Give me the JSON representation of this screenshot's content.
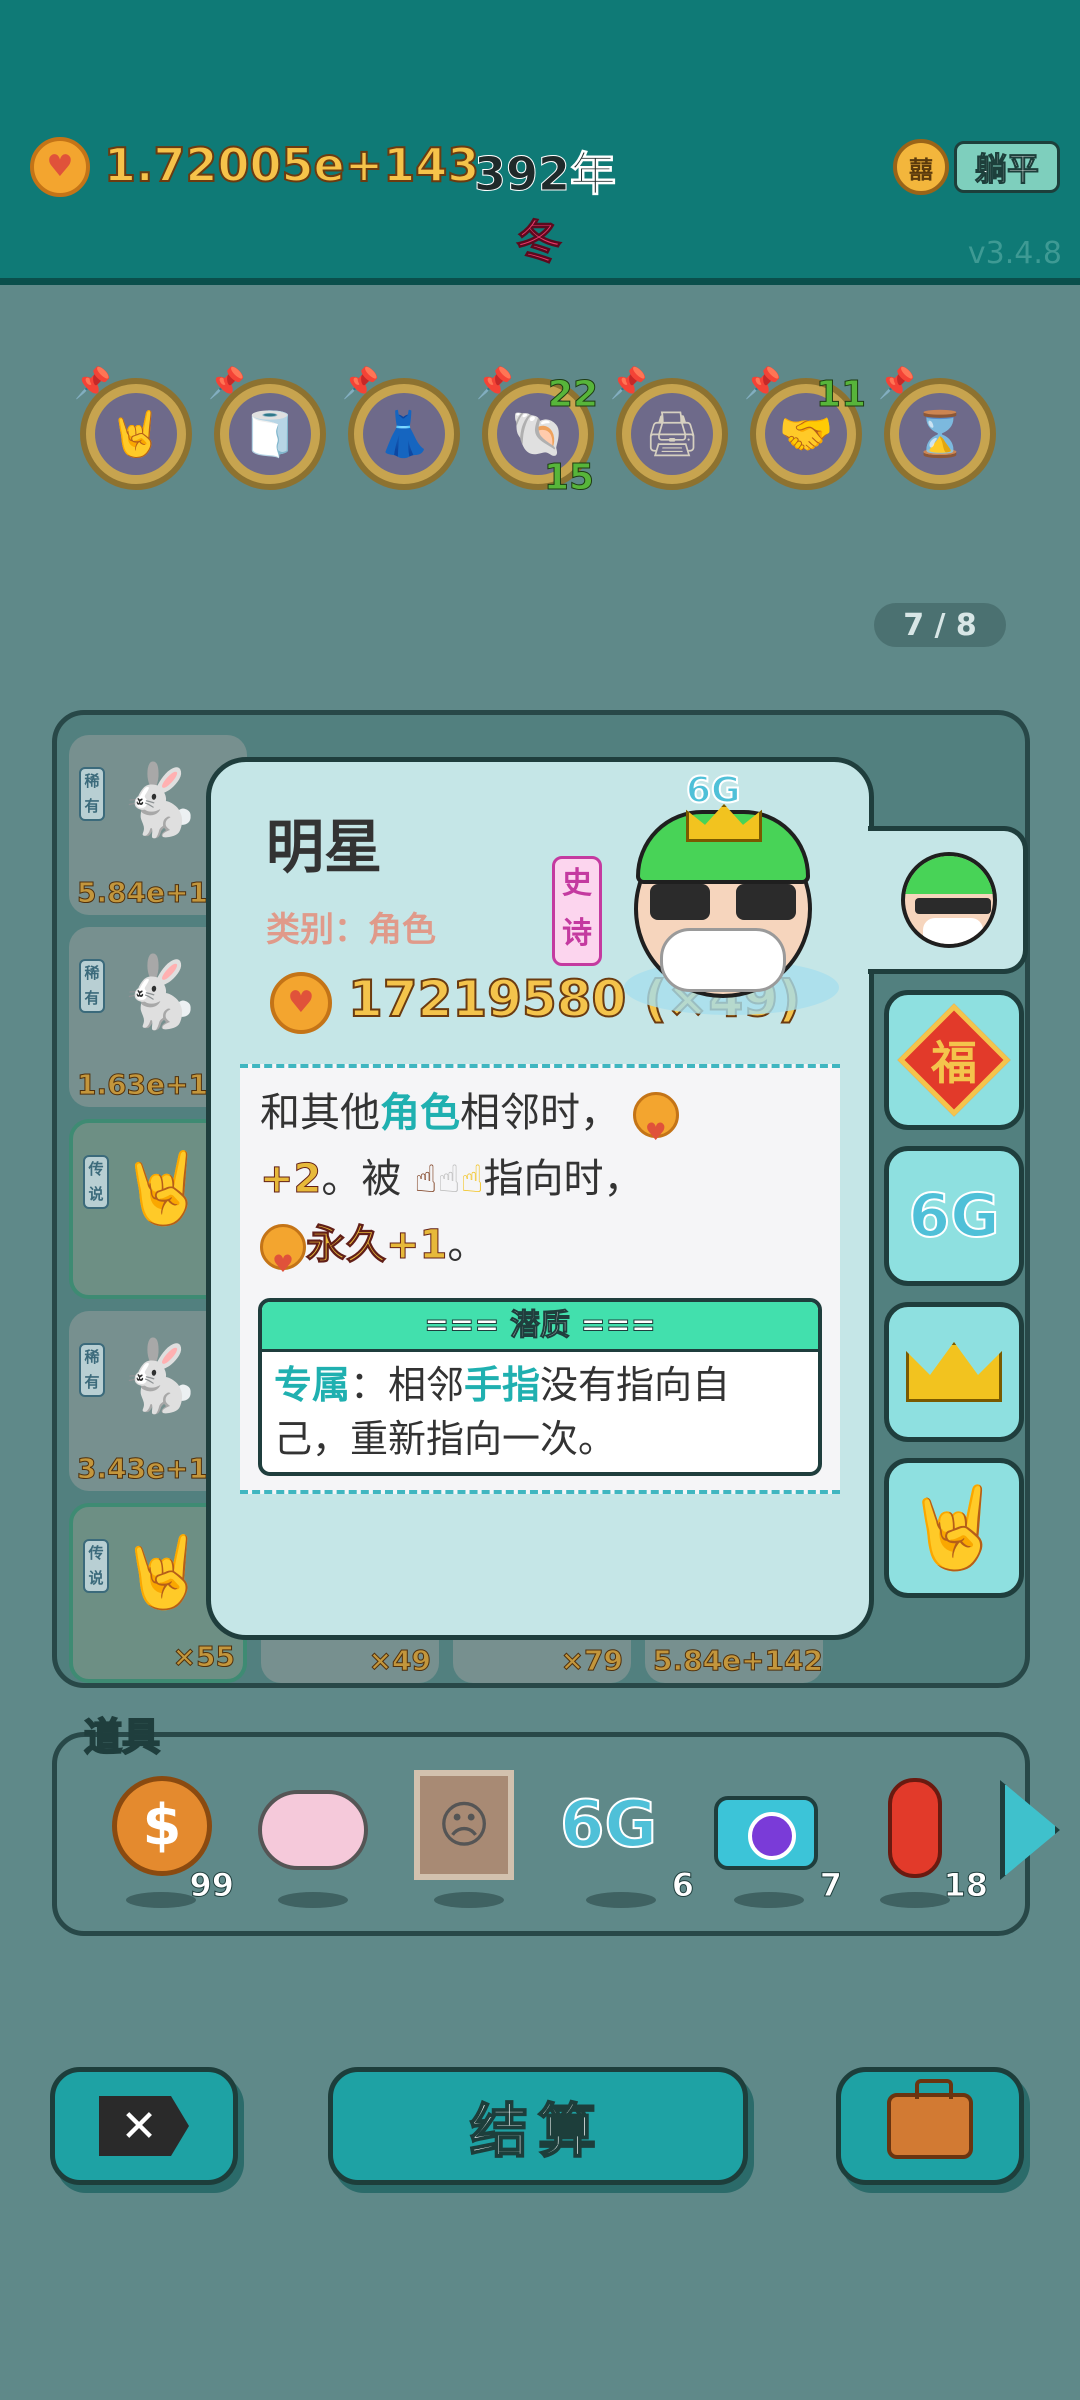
{
  "header": {
    "coin_total": "1.72005e+143",
    "year": "392年",
    "season": "冬",
    "seal_glyph": "囍",
    "lie_flat_label": "躺平",
    "version": "v3.4.8"
  },
  "relics": [
    {
      "icon": "rock-hand-icon",
      "glyph": "🤘",
      "count_top": "",
      "count_bottom": ""
    },
    {
      "icon": "tissue-box-icon",
      "glyph": "🧻",
      "count_top": "",
      "count_bottom": ""
    },
    {
      "icon": "skirt-icon",
      "glyph": "👗",
      "count_top": "",
      "count_bottom": ""
    },
    {
      "icon": "shell-icon",
      "glyph": "🐚",
      "count_top": "22",
      "count_bottom": "15"
    },
    {
      "icon": "printer-icon",
      "glyph": "🖨",
      "count_top": "",
      "count_bottom": ""
    },
    {
      "icon": "handshake-icon",
      "glyph": "🤝",
      "count_top": "11",
      "count_bottom": ""
    },
    {
      "icon": "time-poster-icon",
      "glyph": "⌛",
      "count_top": "",
      "count_bottom": ""
    }
  ],
  "page_indicator": "7 / 8",
  "board": {
    "cells": [
      {
        "tag": "稀有",
        "value": "5.84e+1"
      },
      {
        "tag": "稀有",
        "value": "1.63e+1"
      },
      {
        "tag": "传说",
        "value": ""
      },
      {
        "tag": "稀有",
        "value": "3.43e+1"
      },
      {
        "tag": "传说",
        "value": "×55"
      },
      {
        "tag": "",
        "value": "×49"
      },
      {
        "tag": "",
        "value": "×79"
      },
      {
        "tag": "",
        "value": "5.84e+142"
      }
    ]
  },
  "detail": {
    "name": "明星",
    "category": "类别：角色",
    "rarity": "史诗",
    "value": "17219580 (×49)",
    "portrait_badge": "6G",
    "desc": {
      "p1": "和其他",
      "kw1": "角色",
      "p2": "相邻时，",
      "num1": "+2",
      "p3": "。被",
      "p4": "指向时，",
      "num2": "永久+1",
      "p5": "。"
    },
    "trait_header": "=== 潜质 ===",
    "trait": {
      "kw1": "专属",
      "p1": "：相邻",
      "kw2": "手指",
      "p2": "没有指向自己，重新指向一次。"
    }
  },
  "side_tabs": [
    {
      "icon": "character-portrait-icon"
    },
    {
      "icon": "fu-charm-icon",
      "glyph": "福"
    },
    {
      "icon": "6g-icon",
      "glyph": "6G"
    },
    {
      "icon": "crown-icon"
    },
    {
      "icon": "pointing-hand-icon",
      "glyph": "🤘"
    }
  ],
  "items": {
    "label": "道具",
    "list": [
      {
        "icon": "dollar-coin-icon",
        "glyph": "$",
        "count": "99"
      },
      {
        "icon": "piggy-bank-icon",
        "count": ""
      },
      {
        "icon": "framed-portrait-icon",
        "glyph": "☹",
        "count": ""
      },
      {
        "icon": "6g-icon",
        "glyph": "6G",
        "count": "6"
      },
      {
        "icon": "camera-icon",
        "count": "7"
      },
      {
        "icon": "chili-pepper-icon",
        "count": "18"
      }
    ]
  },
  "buttons": {
    "discard_glyph": "✕",
    "settle_label": "结算"
  },
  "colors": {
    "header_bg": "#0f7a76",
    "page_bg": "#5f8989",
    "card_bg": "#c5e6e7",
    "accent_teal": "#1fb0b0",
    "coin_gold": "#f4c44c"
  }
}
